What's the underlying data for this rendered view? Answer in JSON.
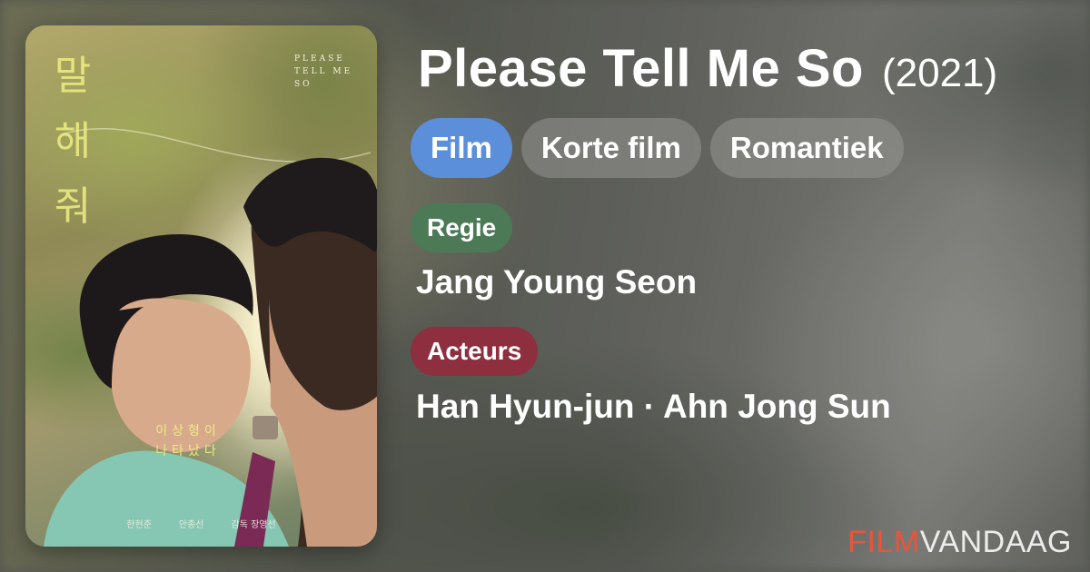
{
  "poster": {
    "korean_title": "말\n해\n줘",
    "english_title": "PLEASE\nTELL ME\nSO",
    "tagline": "이상형이\n나타났다",
    "credits": [
      "한현준",
      "안종선",
      "감독 장영선"
    ]
  },
  "movie": {
    "title": "Please Tell Me So",
    "year": "(2021)"
  },
  "genres": [
    {
      "label": "Film",
      "active": true
    },
    {
      "label": "Korte film",
      "active": false
    },
    {
      "label": "Romantiek",
      "active": false
    }
  ],
  "director": {
    "label": "Regie",
    "value": "Jang Young Seon"
  },
  "cast": {
    "label": "Acteurs",
    "value": "Han Hyun-jun · Ahn Jong Sun"
  },
  "brand": {
    "part1": "FILM",
    "part2": "VANDAAG"
  },
  "colors": {
    "chip_active": "#5b8fda",
    "regie_badge": "#4c7a56",
    "acteurs_badge": "#8d2f3e",
    "brand_accent": "#e9553b"
  }
}
